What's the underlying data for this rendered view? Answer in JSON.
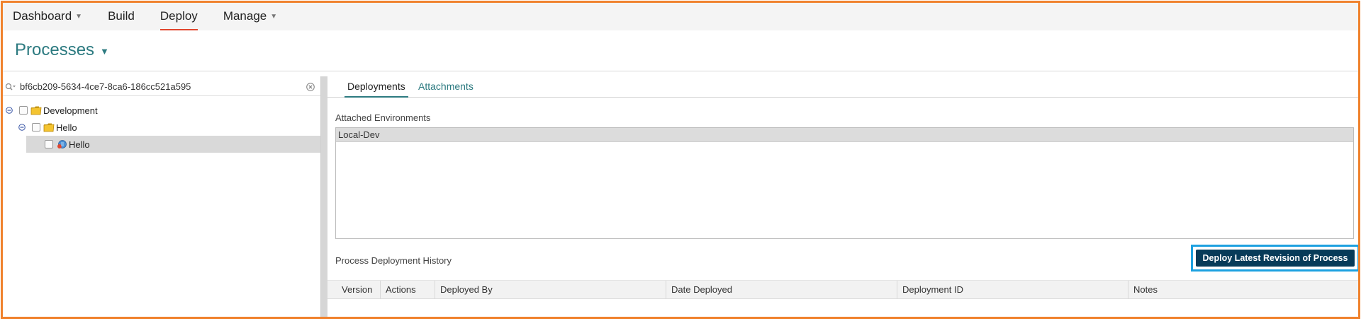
{
  "nav": {
    "items": [
      {
        "label": "Dashboard",
        "has_caret": true
      },
      {
        "label": "Build",
        "has_caret": false
      },
      {
        "label": "Deploy",
        "has_caret": false,
        "active": true
      },
      {
        "label": "Manage",
        "has_caret": true
      }
    ]
  },
  "page": {
    "title": "Processes"
  },
  "search": {
    "value": "bf6cb209-5634-4ce7-8ca6-186cc521a595"
  },
  "tree": [
    {
      "label": "Development",
      "type": "folder",
      "level": 0,
      "expanded": true
    },
    {
      "label": "Hello",
      "type": "folder",
      "level": 1,
      "expanded": true
    },
    {
      "label": "Hello",
      "type": "process",
      "level": 2,
      "selected": true
    }
  ],
  "tabs": {
    "deployments": "Deployments",
    "attachments": "Attachments"
  },
  "environments": {
    "label": "Attached Environments",
    "items": [
      "Local-Dev"
    ]
  },
  "history": {
    "label": "Process Deployment History",
    "deploy_button": "Deploy Latest Revision of Process",
    "columns": [
      "Version",
      "Actions",
      "Deployed By",
      "Date Deployed",
      "Deployment ID",
      "Notes"
    ]
  },
  "colors": {
    "accent": "#2c7a80",
    "nav_active": "#e0452d",
    "button": "#073b59",
    "frame": "#f0822d",
    "highlight": "#1da1e0"
  }
}
